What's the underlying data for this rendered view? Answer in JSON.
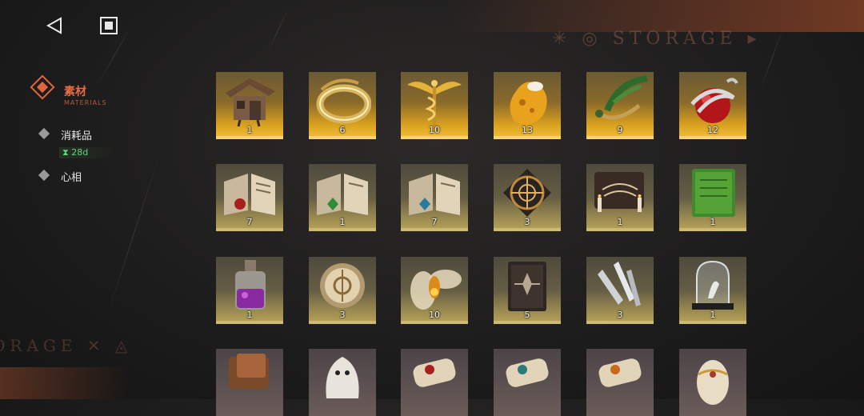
{
  "nav": {
    "back_icon": "back-triangle-icon",
    "home_icon": "square-stop-icon"
  },
  "watermark": {
    "top": "✳ ◎ STORAGE ▸",
    "bottom": "ORAGE ✕ ◬"
  },
  "sidebar": {
    "active": {
      "label": "素材",
      "sub": "MATERIALS"
    },
    "items": [
      {
        "label": "消耗品",
        "timer": "28d"
      },
      {
        "label": "心相"
      }
    ]
  },
  "items": [
    {
      "name": "wooden-hut-item",
      "count": "1",
      "rarity": "gold"
    },
    {
      "name": "golden-ring-item",
      "count": "6",
      "rarity": "gold"
    },
    {
      "name": "winged-caduceus-item",
      "count": "10",
      "rarity": "gold"
    },
    {
      "name": "amber-fossil-item",
      "count": "13",
      "rarity": "gold"
    },
    {
      "name": "herb-wreath-item",
      "count": "9",
      "rarity": "gold"
    },
    {
      "name": "apple-serpent-item",
      "count": "12",
      "rarity": "gold"
    },
    {
      "name": "red-tome-item",
      "count": "7",
      "rarity": "khaki"
    },
    {
      "name": "green-tome-item",
      "count": "1",
      "rarity": "khaki"
    },
    {
      "name": "blue-tome-item",
      "count": "7",
      "rarity": "khaki"
    },
    {
      "name": "astrolabe-item",
      "count": "3",
      "rarity": "khaki"
    },
    {
      "name": "ouija-board-item",
      "count": "1",
      "rarity": "khaki"
    },
    {
      "name": "green-script-item",
      "count": "1",
      "rarity": "khaki"
    },
    {
      "name": "potion-bottle-item",
      "count": "1",
      "rarity": "khaki"
    },
    {
      "name": "brass-compass-item",
      "count": "3",
      "rarity": "khaki"
    },
    {
      "name": "glowing-moth-item",
      "count": "10",
      "rarity": "khaki"
    },
    {
      "name": "leather-book-item",
      "count": "5",
      "rarity": "khaki"
    },
    {
      "name": "silver-bullets-item",
      "count": "3",
      "rarity": "khaki"
    },
    {
      "name": "glass-dome-item",
      "count": "1",
      "rarity": "khaki"
    },
    {
      "name": "leather-wallet-item",
      "count": "",
      "rarity": "purple"
    },
    {
      "name": "ghost-sheet-item",
      "count": "",
      "rarity": "purple"
    },
    {
      "name": "scroll-red-item",
      "count": "",
      "rarity": "purple"
    },
    {
      "name": "scroll-teal-item",
      "count": "",
      "rarity": "purple"
    },
    {
      "name": "scroll-orange-item",
      "count": "",
      "rarity": "purple"
    },
    {
      "name": "ornate-egg-item",
      "count": "",
      "rarity": "purple"
    }
  ],
  "colors": {
    "accent": "#e0663e",
    "timer": "#5ed67a",
    "gold": "#f3c234",
    "khaki": "#b9a45a"
  }
}
